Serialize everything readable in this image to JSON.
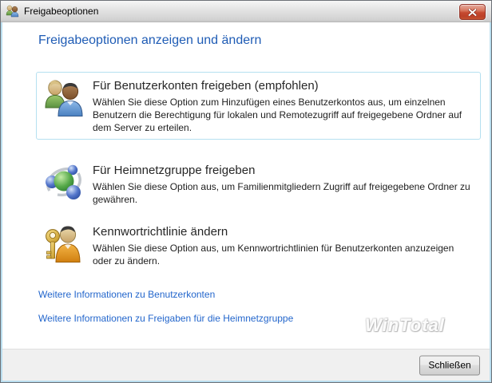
{
  "window": {
    "title": "Freigabeoptionen"
  },
  "heading": "Freigabeoptionen anzeigen und ändern",
  "options": [
    {
      "title": "Für Benutzerkonten freigeben (empfohlen)",
      "description": "Wählen Sie diese Option zum Hinzufügen eines Benutzerkontos aus, um einzelnen Benutzern die Berechtigung für lokalen und Remotezugriff auf freigegebene Ordner auf dem Server zu erteilen.",
      "icon": "users-icon",
      "selected": true
    },
    {
      "title": "Für Heimnetzgruppe freigeben",
      "description": "Wählen Sie diese Option aus, um Familienmitgliedern Zugriff auf freigegebene Ordner zu gewähren.",
      "icon": "homegroup-icon",
      "selected": false
    },
    {
      "title": "Kennwortrichtlinie ändern",
      "description": "Wählen Sie diese Option aus, um Kennwortrichtlinien für Benutzerkonten anzuzeigen oder zu ändern.",
      "icon": "key-user-icon",
      "selected": false
    }
  ],
  "links": [
    {
      "label": "Weitere Informationen zu Benutzerkonten"
    },
    {
      "label": "Weitere Informationen zu Freigaben für die Heimnetzgruppe"
    }
  ],
  "watermark": "WinTotal",
  "footer": {
    "close_button": "Schließen"
  },
  "colors": {
    "heading_blue": "#1f5cb5",
    "link_blue": "#2366cc",
    "selected_border": "#b5e0f0",
    "close_button_red": "#c54930",
    "footer_gray": "#f0f0f0"
  }
}
